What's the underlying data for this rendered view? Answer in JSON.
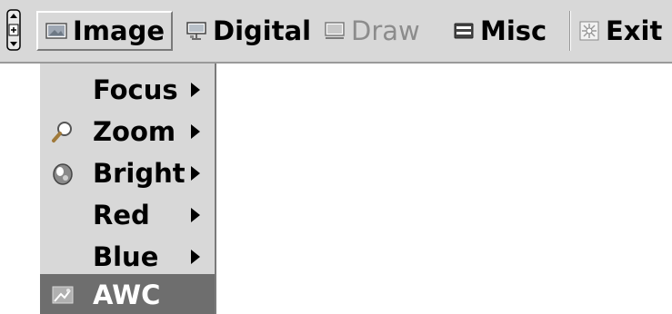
{
  "menubar": {
    "items": [
      {
        "label": "Image",
        "icon": "image-icon",
        "state": "active"
      },
      {
        "label": "Digital",
        "icon": "digital-icon",
        "state": "enabled"
      },
      {
        "label": "Draw",
        "icon": "draw-icon",
        "state": "disabled"
      },
      {
        "label": "Misc",
        "icon": "misc-icon",
        "state": "enabled"
      },
      {
        "label": "Exit",
        "icon": "exit-icon",
        "state": "enabled"
      }
    ]
  },
  "dropdown": {
    "items": [
      {
        "label": "Focus",
        "icon": "",
        "submenu": true
      },
      {
        "label": "Zoom",
        "icon": "magnifier-icon",
        "submenu": true
      },
      {
        "label": "Bright",
        "icon": "bright-icon",
        "submenu": true
      },
      {
        "label": "Red",
        "icon": "",
        "submenu": true
      },
      {
        "label": "Blue",
        "icon": "",
        "submenu": true
      },
      {
        "label": "AWC",
        "icon": "awc-icon",
        "submenu": false,
        "selected": true
      }
    ]
  },
  "colors": {
    "menu_background": "#d8d8d8",
    "selected_background": "#6e6e6e",
    "selected_text": "#ffffff",
    "disabled_text": "#8c8c8c"
  }
}
